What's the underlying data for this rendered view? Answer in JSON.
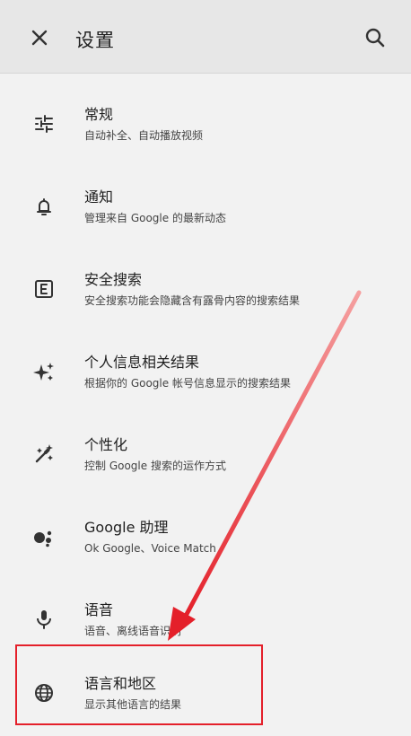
{
  "header": {
    "title": "设置",
    "close_icon": "close-icon",
    "search_icon": "search-icon"
  },
  "items": [
    {
      "label": "常规",
      "desc": "自动补全、自动播放视频",
      "icon": "tune-icon"
    },
    {
      "label": "通知",
      "desc": "管理来自 Google 的最新动态",
      "icon": "bell-icon"
    },
    {
      "label": "安全搜索",
      "desc": "安全搜索功能会隐藏含有露骨内容的搜索结果",
      "icon": "explicit-icon"
    },
    {
      "label": "个人信息相关结果",
      "desc": "根据你的 Google 帐号信息显示的搜索结果",
      "icon": "sparkle-icon"
    },
    {
      "label": "个性化",
      "desc": "控制 Google 搜索的运作方式",
      "icon": "magic-wand-icon"
    },
    {
      "label": "Google 助理",
      "desc": "Ok Google、Voice Match",
      "icon": "assistant-icon"
    },
    {
      "label": "语音",
      "desc": "语音、离线语音识别",
      "icon": "mic-icon"
    },
    {
      "label": "语言和地区",
      "desc": "显示其他语言的结果",
      "icon": "globe-icon"
    }
  ],
  "annotation": {
    "highlight_color": "#e4202a",
    "arrow_color": "#e4202a"
  }
}
